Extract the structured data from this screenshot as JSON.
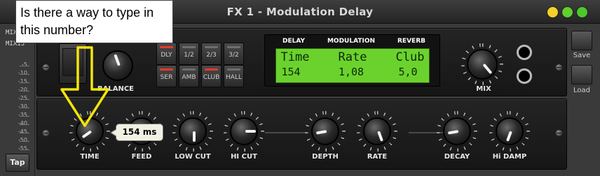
{
  "window": {
    "title": "FX 1 - Modulation Delay"
  },
  "window_controls": [
    {
      "name": "minimize",
      "color": "#f2d22a"
    },
    {
      "name": "restore",
      "color": "#5fd02e"
    },
    {
      "name": "close",
      "color": "#4cc82c"
    }
  ],
  "annotation": {
    "text": "Is there a way to type in this number?"
  },
  "left_panel": {
    "labels": [
      "MIX",
      "MIX13"
    ],
    "scale": [
      "-5",
      "-10",
      "-15",
      "-20",
      "-25",
      "-30",
      "-35",
      "-40",
      "-45",
      "-50",
      "-55"
    ],
    "tap_label": "Tap"
  },
  "top_rack": {
    "balance_label": "BALANCE",
    "mix_label": "MIX",
    "buttons": [
      {
        "label": "DLY",
        "led": "#e63a2a"
      },
      {
        "label": "1/2",
        "led": "#6e6e6e"
      },
      {
        "label": "2/3",
        "led": "#6e6e6e"
      },
      {
        "label": "3/2",
        "led": "#6e6e6e"
      },
      {
        "label": "SER",
        "led": "#e63a2a"
      },
      {
        "label": "AMB",
        "led": "#6e6e6e"
      },
      {
        "label": "CLUB",
        "led": "#e63a2a"
      },
      {
        "label": "HALL",
        "led": "#6e6e6e"
      }
    ],
    "display": {
      "headers": [
        "DELAY",
        "MODULATION",
        "REVERB"
      ],
      "names": [
        "Time",
        "Rate",
        "Club"
      ],
      "values": [
        "154",
        "1,08",
        "5,0"
      ],
      "lcd_color": "#6bd22d"
    }
  },
  "bottom_rack": {
    "knobs": [
      {
        "label": "TIME",
        "angle": -125
      },
      {
        "label": "FEED",
        "angle": -60
      },
      {
        "label": "LOW CUT",
        "angle": 180
      },
      {
        "label": "HI CUT",
        "angle": 90
      },
      {
        "label": "DEPTH",
        "angle": -100
      },
      {
        "label": "RATE",
        "angle": 160
      },
      {
        "label": "DECAY",
        "angle": -100
      },
      {
        "label": "Hi DAMP",
        "angle": -160
      }
    ],
    "tooltip": "154 ms"
  },
  "side_buttons": [
    {
      "label": "Save"
    },
    {
      "label": "Load"
    }
  ]
}
